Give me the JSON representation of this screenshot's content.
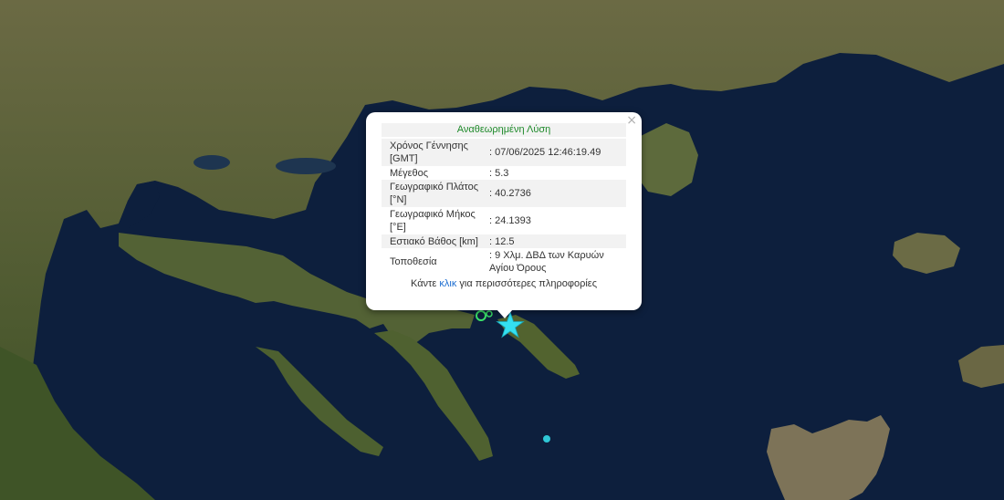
{
  "popup": {
    "title": "Αναθεωρημένη Λύση",
    "close": "×",
    "rows": [
      {
        "label": "Χρόνος Γέννησης [GMT]",
        "value": ": 07/06/2025 12:46:19.49"
      },
      {
        "label": "Μέγεθος",
        "value": ": 5.3"
      },
      {
        "label": "Γεωγραφικό Πλάτος [°N]",
        "value": ": 40.2736"
      },
      {
        "label": "Γεωγραφικό Μήκος [°E]",
        "value": ": 24.1393"
      },
      {
        "label": "Εστιακό Βάθος [km]",
        "value": ": 12.5"
      },
      {
        "label": "Τοποθεσία",
        "value": ": 9 Χλμ. ΔΒΔ των Καρυών Αγίου Όρους"
      }
    ],
    "more_prefix": "Κάντε",
    "more_link": "κλικ",
    "more_suffix": "για περισσότερες πληροφορίες"
  },
  "colors": {
    "sea": "#0d1f3d",
    "land": "#4e5a2c",
    "epicenter_star": "#34e0f0",
    "event_ring": "#3be36a"
  },
  "icons": {
    "epicenter": "star-icon",
    "events": "circle-icon"
  }
}
